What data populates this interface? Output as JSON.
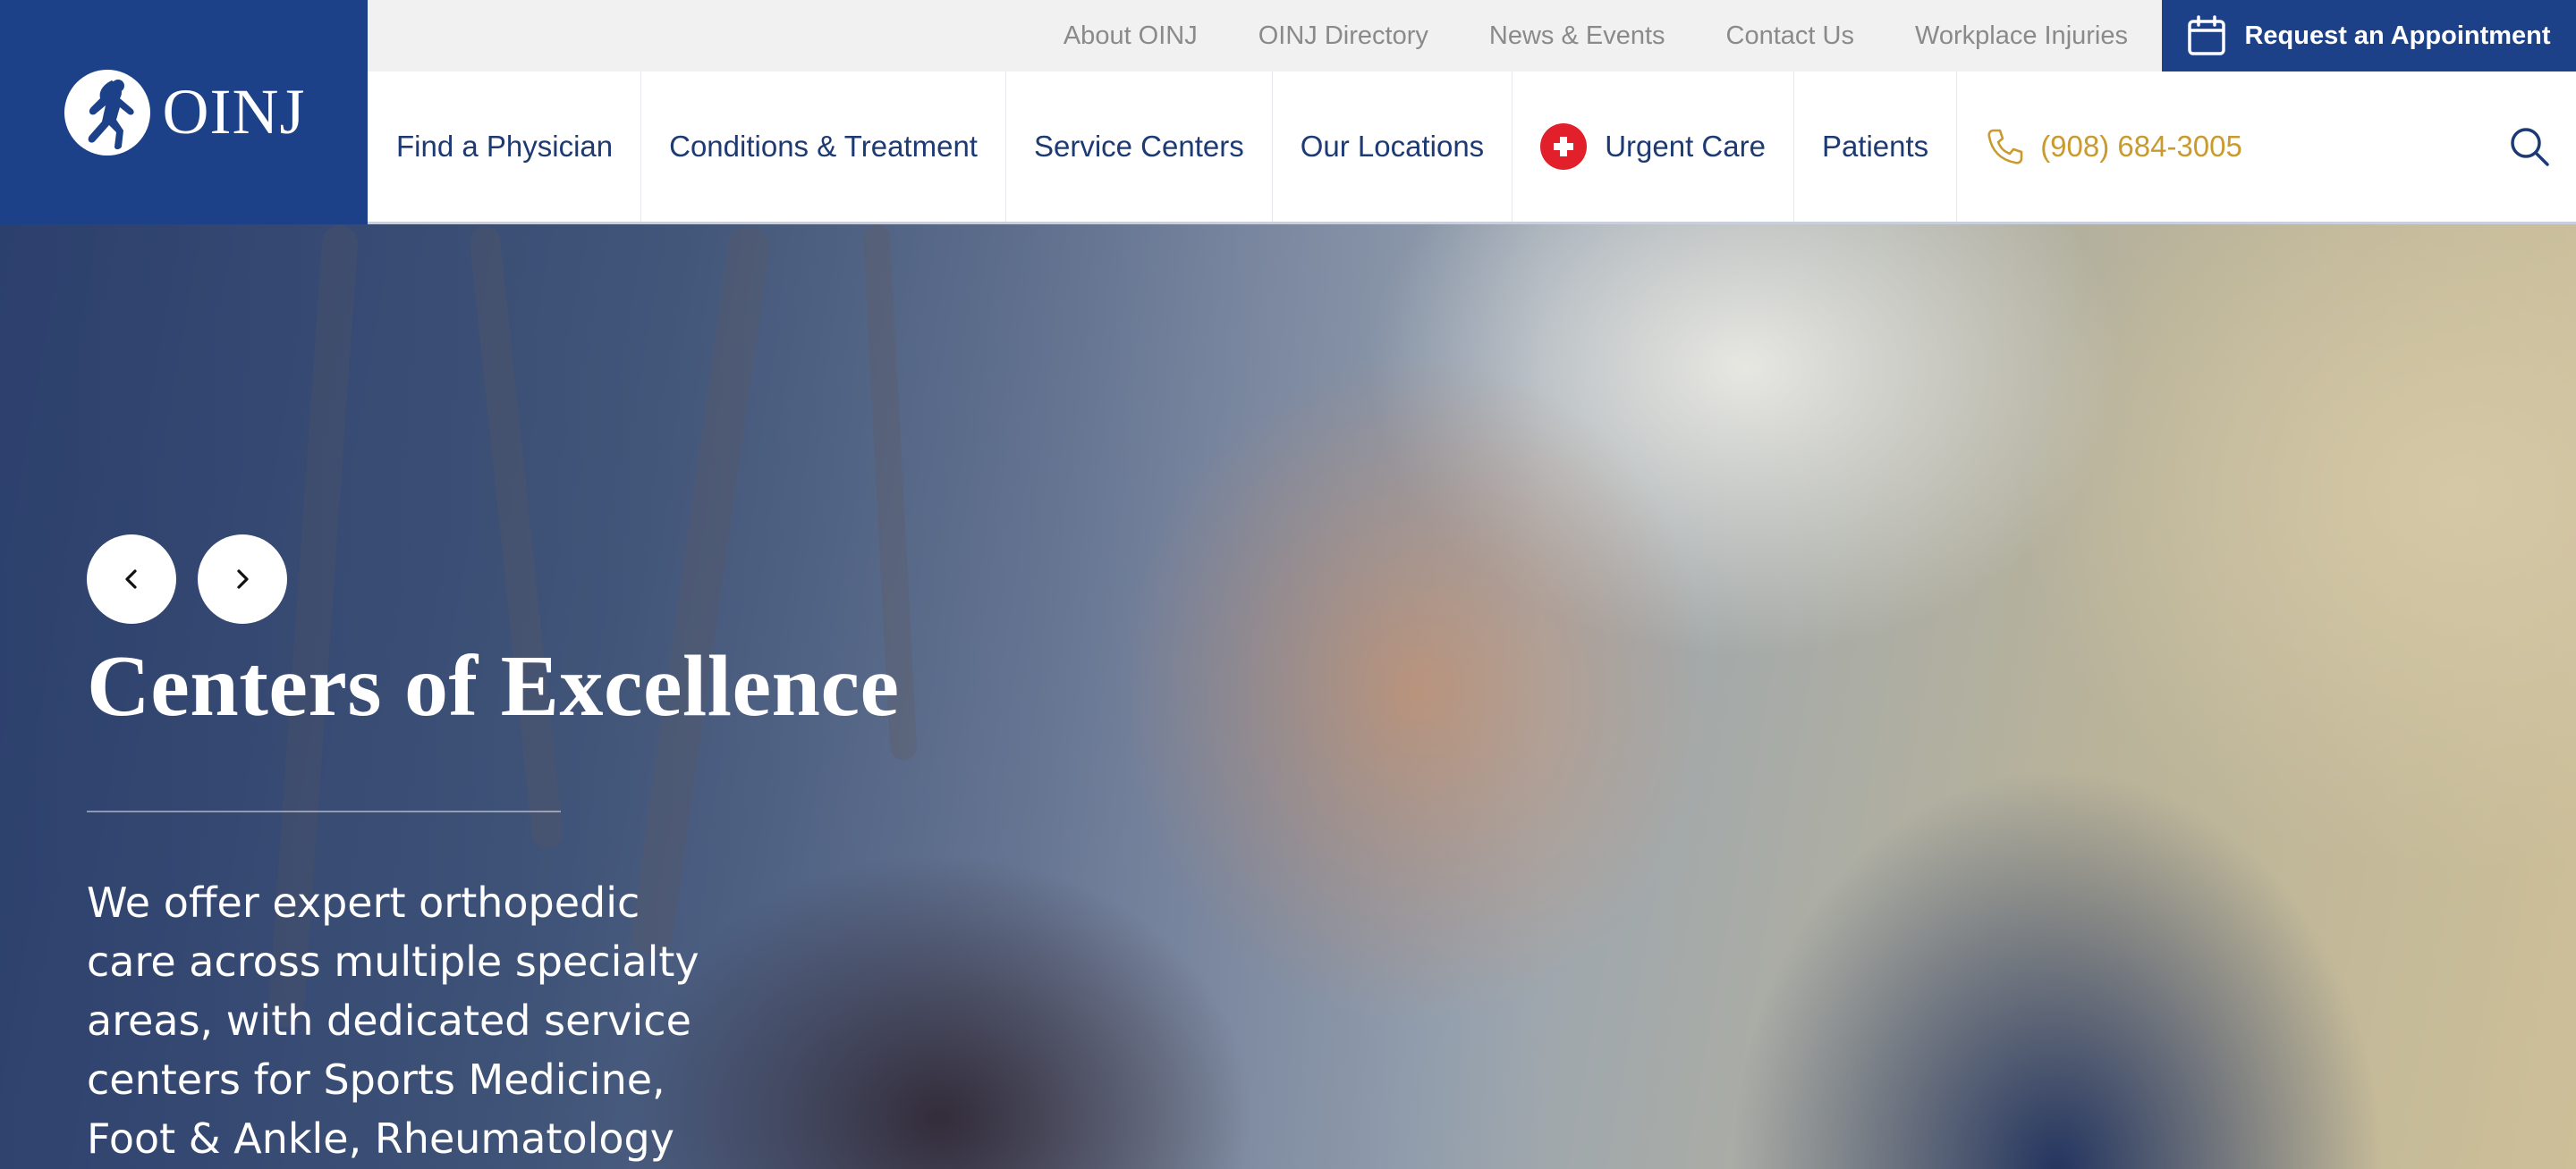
{
  "brand": {
    "logo_text": "OINJ"
  },
  "utility": {
    "links": [
      "About OINJ",
      "OINJ Directory",
      "News & Events",
      "Contact Us",
      "Workplace Injuries"
    ],
    "appointment_label": "Request an Appointment"
  },
  "nav": {
    "items": [
      "Find a Physician",
      "Conditions & Treatment",
      "Service Centers",
      "Our Locations",
      "Urgent Care",
      "Patients"
    ],
    "phone": "(908) 684-3005"
  },
  "hero": {
    "title": "Centers of Excellence",
    "body": "We offer expert orthopedic care across multiple specialty areas, with dedicated service centers for Sports Medicine, Foot & Ankle, Rheumatology"
  },
  "colors": {
    "brand_blue": "#1d4189",
    "nav_text": "#1d3a73",
    "phone_gold": "#c99a2e",
    "urgent_red": "#e2202b"
  }
}
